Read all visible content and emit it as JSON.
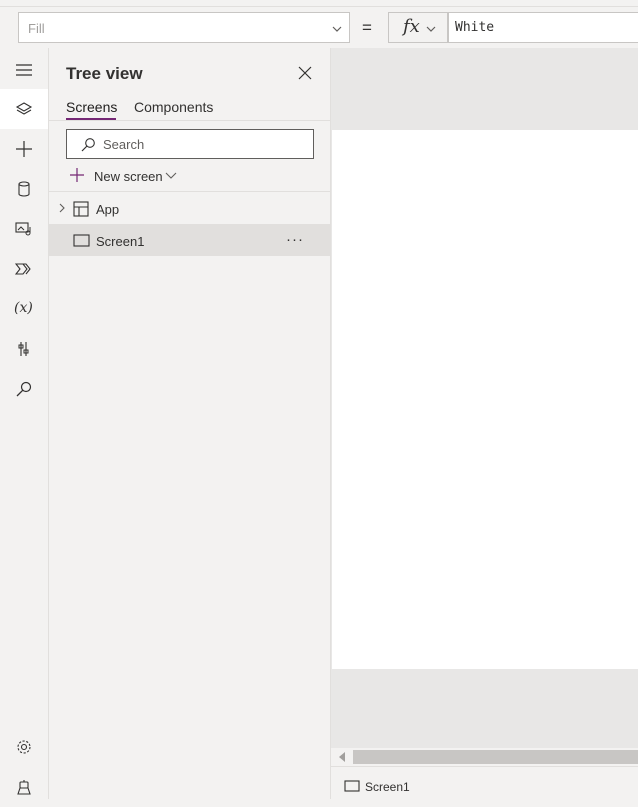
{
  "formula_bar": {
    "property_value": "Fill",
    "equals": "=",
    "fx_label": "fx",
    "formula_value": "White"
  },
  "rail": {
    "items": [
      {
        "icon": "hamburger-icon"
      },
      {
        "icon": "layers-icon",
        "active": true
      },
      {
        "icon": "plus-icon"
      },
      {
        "icon": "database-icon"
      },
      {
        "icon": "media-icon"
      },
      {
        "icon": "power-automate-icon"
      },
      {
        "icon": "variables-icon",
        "text": "(x)"
      },
      {
        "icon": "advanced-tools-icon"
      },
      {
        "icon": "search-icon"
      },
      {
        "icon": "settings-icon"
      },
      {
        "icon": "virtual-agent-icon"
      }
    ]
  },
  "tree_view": {
    "title": "Tree view",
    "tabs": [
      {
        "label": "Screens",
        "selected": true
      },
      {
        "label": "Components",
        "selected": false
      }
    ],
    "search": {
      "placeholder": "Search",
      "value": ""
    },
    "new_screen_label": "New screen",
    "items": [
      {
        "label": "App",
        "icon": "app-icon",
        "expandable": true,
        "selected": false
      },
      {
        "label": "Screen1",
        "icon": "screen-icon",
        "expandable": false,
        "selected": true,
        "more": "···"
      }
    ]
  },
  "canvas": {
    "status_screen_label": "Screen1"
  },
  "colors": {
    "accent": "#742774",
    "panel_bg": "#f3f2f1",
    "selected_row": "#e1dfdd"
  }
}
